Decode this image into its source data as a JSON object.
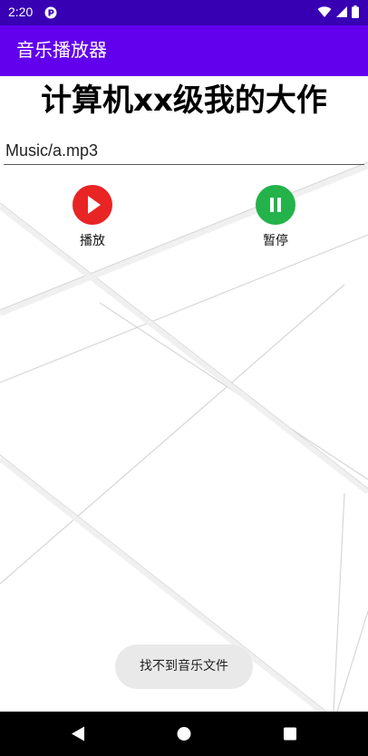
{
  "status_bar": {
    "time": "2:20",
    "app_icon": "notification-icon",
    "icons": [
      "wifi-icon",
      "signal-icon",
      "battery-icon"
    ],
    "background": "#3700b3"
  },
  "app_bar": {
    "title": "音乐播放器",
    "background": "#6200ee"
  },
  "main": {
    "headline": "计算机xx级我的大作",
    "path_value": "Music/a.mp3",
    "controls": [
      {
        "label": "播放",
        "icon": "play-icon",
        "color": "#e82424"
      },
      {
        "label": "暂停",
        "icon": "pause-icon",
        "color": "#23b34a"
      }
    ]
  },
  "toast": {
    "message": "找不到音乐文件"
  },
  "nav_bar": {
    "buttons": [
      "back-icon",
      "home-icon",
      "recents-icon"
    ]
  }
}
